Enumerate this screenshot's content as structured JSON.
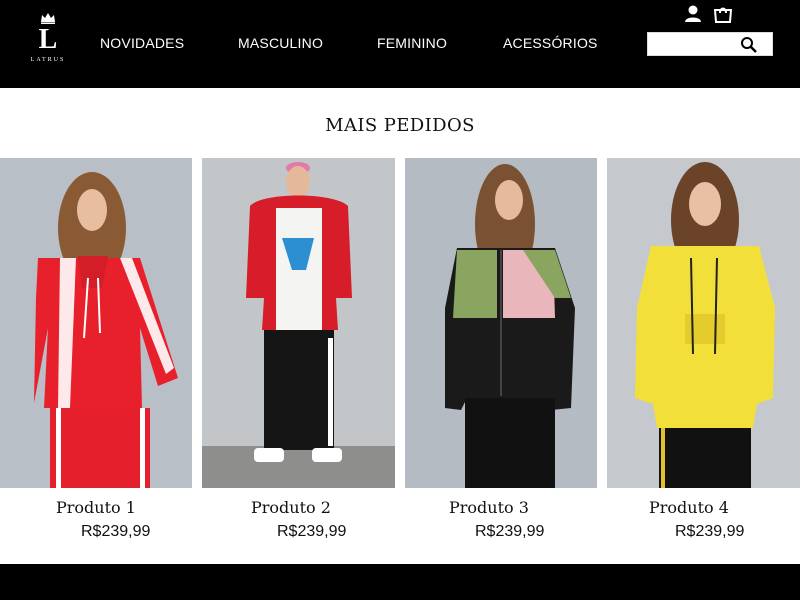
{
  "brand": {
    "initial": "L",
    "name": "LATRUS"
  },
  "nav": [
    "NOVIDADES",
    "MASCULINO",
    "FEMININO",
    "ACESSÓRIOS"
  ],
  "icons": {
    "account": "user-icon",
    "cart": "shopping-bag-icon",
    "search": "search-icon"
  },
  "search": {
    "value": "",
    "placeholder": ""
  },
  "section": {
    "title": "MAIS PEDIDOS"
  },
  "products": [
    {
      "name": "Produto 1",
      "price": "R$239,99",
      "jacket_color": "#e8202c",
      "pants_color": "#e51f2b"
    },
    {
      "name": "Produto 2",
      "price": "R$239,99",
      "jacket_color": "#d71d2a",
      "pants_color": "#111111"
    },
    {
      "name": "Produto 3",
      "price": "R$239,99",
      "jacket_color": "#1a1a1a",
      "pants_color": "#111111"
    },
    {
      "name": "Produto 4",
      "price": "R$239,99",
      "jacket_color": "#f3df3a",
      "pants_color": "#111111"
    }
  ],
  "colors": {
    "header_bg": "#000000",
    "photo_bg": "#b7bec6",
    "footer_bg": "#000000"
  }
}
